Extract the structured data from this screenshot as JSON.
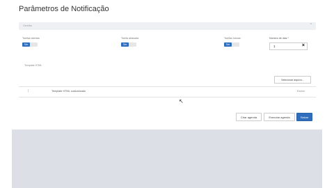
{
  "page": {
    "title": "Parâmetros de Notificação"
  },
  "section": {
    "label": "Gestão"
  },
  "options": [
    {
      "label": "Tarefas abertas",
      "value": "Sim"
    },
    {
      "label": "Tarefa atrasada",
      "value": "Sim"
    },
    {
      "label": "Tarefas futuras",
      "value": "Sim"
    }
  ],
  "days": {
    "label": "Número de dias *",
    "value": "1"
  },
  "template": {
    "label": "Template HTML",
    "select_file_label": "Selecionar arquivo...",
    "row_name": "Template HTML customizado",
    "row_action": "Excluir"
  },
  "footer": {
    "create_schedule": "Criar agenda",
    "run_schedule": "Executar agenda",
    "save": "Salvar"
  },
  "colors": {
    "accent": "#2f6dbd",
    "background": "#dcdfe5"
  }
}
